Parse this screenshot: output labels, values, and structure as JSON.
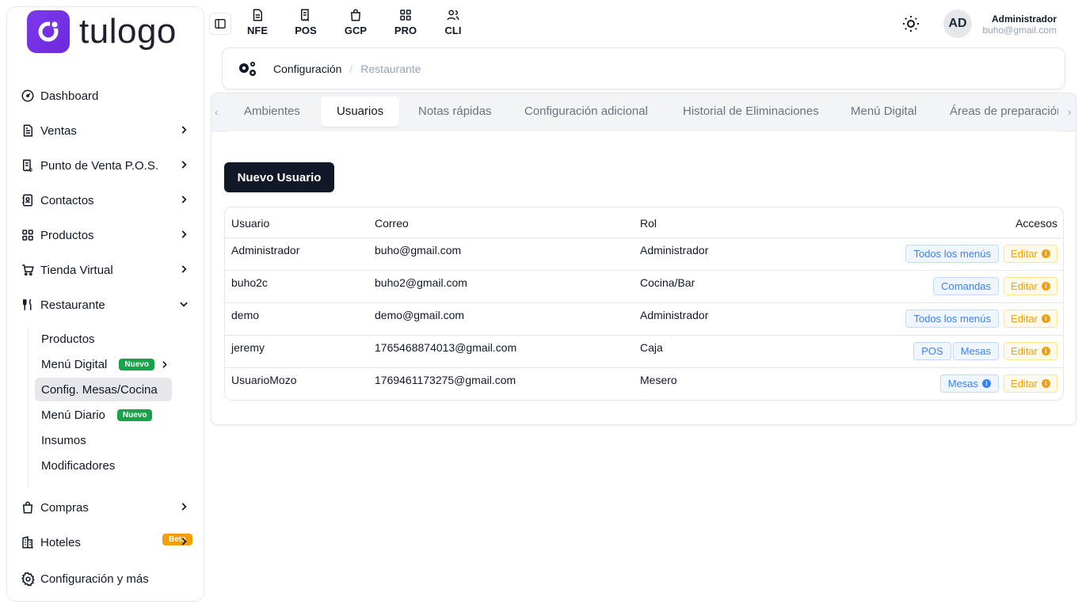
{
  "brand": {
    "name": "tulogo"
  },
  "sidebar": {
    "items": [
      {
        "label": "Dashboard",
        "icon": "gauge-icon"
      },
      {
        "label": "Ventas",
        "icon": "document-icon"
      },
      {
        "label": "Punto de Venta P.O.S.",
        "icon": "receipt-icon"
      },
      {
        "label": "Contactos",
        "icon": "contacts-icon"
      },
      {
        "label": "Productos",
        "icon": "grid-icon"
      },
      {
        "label": "Tienda Virtual",
        "icon": "cart-icon"
      },
      {
        "label": "Restaurante",
        "icon": "utensils-icon"
      },
      {
        "label": "Compras",
        "icon": "bag-icon"
      },
      {
        "label": "Hoteles",
        "icon": "building-icon",
        "badge": "Beta"
      },
      {
        "label": "Configuración y más",
        "icon": "gear-icon"
      }
    ],
    "sub_items": [
      {
        "label": "Productos"
      },
      {
        "label": "Menú Digital",
        "badge": "Nuevo"
      },
      {
        "label": "Config. Mesas/Cocina"
      },
      {
        "label": "Menú Diario",
        "badge": "Nuevo"
      },
      {
        "label": "Insumos"
      },
      {
        "label": "Modificadores"
      }
    ]
  },
  "topbar": {
    "shortcuts": [
      {
        "label": "NFE",
        "icon": "file-icon"
      },
      {
        "label": "POS",
        "icon": "receipt-icon"
      },
      {
        "label": "GCP",
        "icon": "bag-icon"
      },
      {
        "label": "PRO",
        "icon": "grid-icon"
      },
      {
        "label": "CLI",
        "icon": "users-icon"
      }
    ],
    "avatar_initials": "AD",
    "user_name": "Administrador",
    "user_email": "buho@gmail.com"
  },
  "breadcrumb": {
    "parent": "Configuración",
    "current": "Restaurante"
  },
  "tabs": [
    {
      "label": "Ambientes"
    },
    {
      "label": "Usuarios"
    },
    {
      "label": "Notas rápidas"
    },
    {
      "label": "Configuración adicional"
    },
    {
      "label": "Historial de Eliminaciones"
    },
    {
      "label": "Menú Digital"
    },
    {
      "label": "Áreas de preparación"
    }
  ],
  "active_tab": "Usuarios",
  "new_user_button": "Nuevo Usuario",
  "table": {
    "headers": {
      "usuario": "Usuario",
      "correo": "Correo",
      "rol": "Rol",
      "accesos": "Accesos"
    },
    "rows": [
      {
        "usuario": "Administrador",
        "correo": "buho@gmail.com",
        "rol": "Administrador",
        "accesos": [
          "Todos los menús"
        ],
        "edit": "Editar"
      },
      {
        "usuario": "buho2c",
        "correo": "buho2@gmail.com",
        "rol": "Cocina/Bar",
        "accesos": [
          "Comandas"
        ],
        "edit": "Editar"
      },
      {
        "usuario": "demo",
        "correo": "demo@gmail.com",
        "rol": "Administrador",
        "accesos": [
          "Todos los menús"
        ],
        "edit": "Editar"
      },
      {
        "usuario": "jeremy",
        "correo": "1765468874013@gmail.com",
        "rol": "Caja",
        "accesos": [
          "POS",
          "Mesas"
        ],
        "edit": "Editar"
      },
      {
        "usuario": "UsuarioMozo",
        "correo": "1769461173275@gmail.com",
        "rol": "Mesero",
        "accesos": [
          "Mesas"
        ],
        "edit": "Editar"
      }
    ]
  },
  "colors": {
    "brand": "#7c3aed",
    "primary_button": "#111827",
    "access_pill": "#3b82f6",
    "edit_pill": "#f59e0b",
    "new_badge": "#16a34a",
    "beta_badge": "#f59e0b"
  }
}
